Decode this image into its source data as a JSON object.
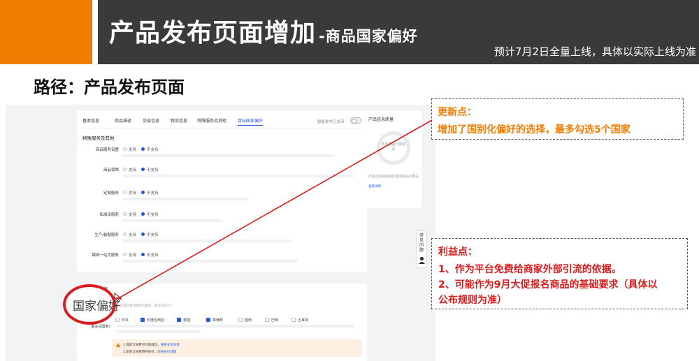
{
  "slide": {
    "title": "产品发布页面增加",
    "title_suffix": "-商品国家偏好",
    "note": "预计7月2日全量上线，具体以实际上线为准",
    "path_label": "路径：产品发布页面"
  },
  "form": {
    "tabs": [
      "基本信息",
      "商品描述",
      "交易信息",
      "物流信息",
      "特殊服务及其他",
      "目标国家偏好"
    ],
    "active_tab": "目标国家偏好",
    "toggle_label": "智能发布已关闭",
    "section_title": "特殊服务及其他",
    "services": [
      {
        "name": "商品服务设置",
        "opt1": "支持",
        "opt2": "不支持"
      },
      {
        "name": "商品保障",
        "opt1": "支持",
        "opt2": "不支持"
      },
      {
        "name": "定制服务",
        "opt1": "支持",
        "opt2": "不支持"
      },
      {
        "name": "私域设服务",
        "opt1": "支持",
        "opt2": "不支持"
      },
      {
        "name": "生产/装配服务",
        "opt1": "支持",
        "opt2": "不支持"
      },
      {
        "name": "跨网一站式服务",
        "opt1": "支持",
        "opt2": "不支持"
      }
    ],
    "side_panel": {
      "title": "产品信息质量",
      "circle_text": "暂无商品分类信息",
      "desc": "产品信息质量将直接影响排名和曝光",
      "link": "查看详情"
    },
    "preference": {
      "section_title": "目标国家偏好",
      "circled_label": "国家偏好",
      "help_text": "可设置您希望推荐的国家，最多勾选5个",
      "question": "最关注国家?",
      "countries": [
        {
          "name": "日本",
          "checked": false
        },
        {
          "name": "印度尼西亚",
          "checked": true
        },
        {
          "name": "泰国",
          "checked": true
        },
        {
          "name": "菲律宾",
          "checked": true
        },
        {
          "name": "越南",
          "checked": false
        },
        {
          "name": "巴西",
          "checked": false
        },
        {
          "name": "土耳其",
          "checked": false
        }
      ],
      "warn_lines": [
        {
          "text": "1.目前订阅费已付款成功，",
          "link": "查看支付详情"
        },
        {
          "text": "2.新的订阅费用待支付，",
          "link": "前往支付详情"
        }
      ]
    },
    "side_contact": "常见问题"
  },
  "callouts": {
    "update_head": "更新点：",
    "update_body": "增加了国别化偏好的选择，最多勾选5个国家",
    "benefit_head": "利益点：",
    "benefit_lines": [
      "1、作为平台免费给商家外部引流的依据。",
      "2、可能作为9月大促报名商品的基础要求（具体以",
      "公布规则为准）"
    ]
  },
  "colors": {
    "accent_orange": "#f07c00",
    "title_bar": "#3a3a3a",
    "highlight_red": "#d91d1d",
    "link_blue": "#2458e0"
  }
}
